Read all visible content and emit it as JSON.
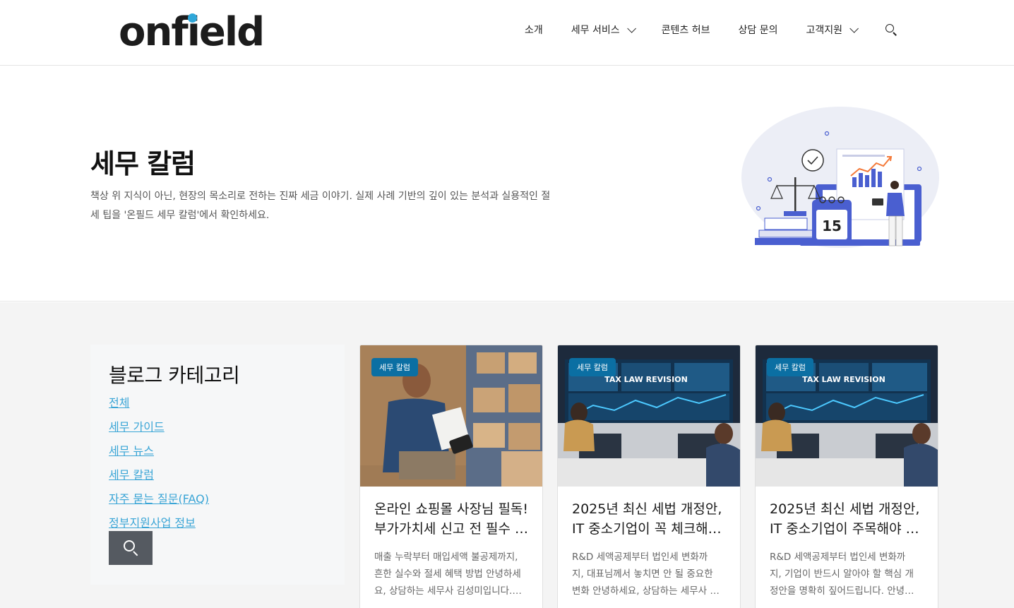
{
  "header": {
    "logo_text": "onfield",
    "nav": [
      {
        "label": "소개",
        "has_dropdown": false
      },
      {
        "label": "세무 서비스",
        "has_dropdown": true
      },
      {
        "label": "콘텐츠 허브",
        "has_dropdown": false
      },
      {
        "label": "상담 문의",
        "has_dropdown": false
      },
      {
        "label": "고객지원",
        "has_dropdown": true
      }
    ],
    "search_icon": "search-icon"
  },
  "hero": {
    "title": "세무 칼럼",
    "description": "책상 위 지식이 아닌, 현장의 목소리로 전하는 진짜 세금 이야기. 실제 사례 기반의 깊이 있는 분석과 실용적인 절세 팁을 '온필드 세무 칼럼'에서 확인하세요.",
    "illustration_calendar_number": "15"
  },
  "sidebar": {
    "title": "블로그 카테고리",
    "categories": [
      "전체",
      "세무 가이드",
      "세무 뉴스",
      "세무 칼럼",
      "자주 묻는 질문(FAQ)",
      "정부지원사업 정보"
    ],
    "search_icon": "search-icon"
  },
  "cards": [
    {
      "badge": "세무 칼럼",
      "title_lines": [
        "온라인 쇼핑몰 사장님 필독!",
        "부가가치세 신고 전 필수 …"
      ],
      "excerpt_lines": [
        "매출 누락부터 매입세액 불공제까지,",
        "흔한 실수와 절세 혜택 방법 안녕하세",
        "요, 상담하는 세무사 김성미입니다.…"
      ],
      "image": "warehouse-worker-photo"
    },
    {
      "badge": "세무 칼럼",
      "title_lines": [
        "2025년 최신 세법 개정안,",
        "IT 중소기업이 꼭 체크해…"
      ],
      "excerpt_lines": [
        "R&D 세액공제부터 법인세 변화까",
        "지, 대표님께서 놓치면 안 될 중요한",
        "변화 안녕하세요, 상담하는 세무사 …"
      ],
      "image": "tax-law-revision-office-photo",
      "screen_text": "TAX LAW REVISION"
    },
    {
      "badge": "세무 칼럼",
      "title_lines": [
        "2025년 최신 세법 개정안,",
        "IT 중소기업이 주목해야 …"
      ],
      "excerpt_lines": [
        "R&D 세액공제부터 법인세 변화까",
        "지, 기업이 반드시 알아야 할 핵심 개",
        "정안을 명확히 짚어드립니다. 안녕…"
      ],
      "image": "tax-law-revision-office-photo",
      "screen_text": "TAX LAW REVISION"
    }
  ],
  "colors": {
    "accent_link": "#3aa5d6",
    "badge_bg": "#0b6fa3",
    "logo_dot": "#2fa7d9",
    "content_bg": "#f4f4f4",
    "search_button_bg": "#555a61"
  }
}
